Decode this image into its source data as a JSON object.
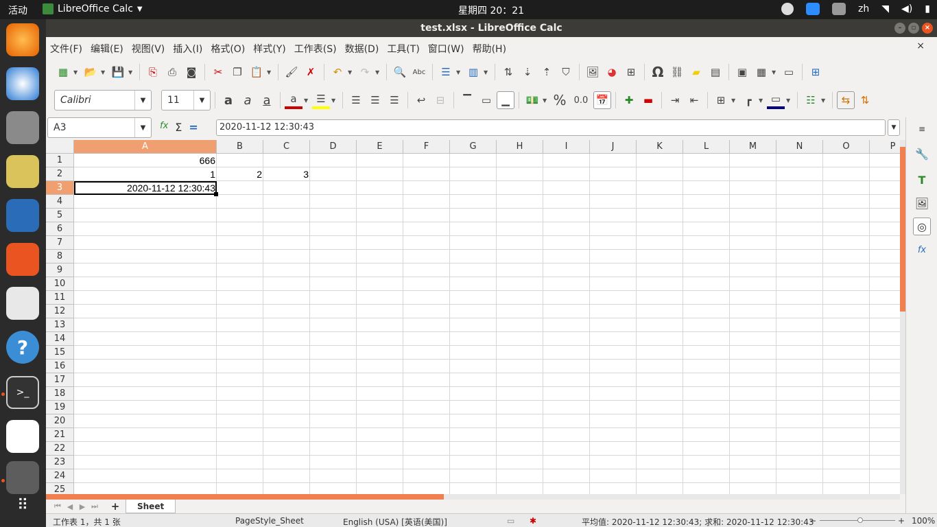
{
  "topbar": {
    "activities": "活动",
    "app_name": "LibreOffice Calc",
    "clock": "星期四 20：21",
    "lang": "zh"
  },
  "window": {
    "title": "test.xlsx - LibreOffice Calc"
  },
  "menu": [
    "文件(F)",
    "编辑(E)",
    "视图(V)",
    "插入(I)",
    "格式(O)",
    "样式(Y)",
    "工作表(S)",
    "数据(D)",
    "工具(T)",
    "窗口(W)",
    "帮助(H)"
  ],
  "formatting": {
    "font_name": "Calibri",
    "font_size": "11",
    "percent_label": "%",
    "number_label": "0.0"
  },
  "formula_bar": {
    "name_box": "A3",
    "content": "2020-11-12 12:30:43"
  },
  "columns": [
    "A",
    "B",
    "C",
    "D",
    "E",
    "F",
    "G",
    "H",
    "I",
    "J",
    "K",
    "L",
    "M",
    "N",
    "O",
    "P"
  ],
  "selected_column": "A",
  "rows": [
    "1",
    "2",
    "3",
    "4",
    "5",
    "6",
    "7",
    "8",
    "9",
    "10",
    "11",
    "12",
    "13",
    "14",
    "15",
    "16",
    "17",
    "18",
    "19",
    "20",
    "21",
    "22",
    "23",
    "24",
    "25"
  ],
  "selected_row": "3",
  "cells": {
    "A1": "666",
    "A2": "1",
    "B2": "2",
    "C2": "3",
    "A3": "2020-11-12 12:30:43"
  },
  "sheet_tab": "Sheet",
  "status": {
    "sheet_count": "工作表 1，共 1 张",
    "page_style": "PageStyle_Sheet",
    "language": "English (USA) [英语(美国)]",
    "summary": "平均值: 2020-11-12 12:30:43; 求和: 2020-11-12 12:30:43",
    "zoom": "100%"
  },
  "colors": {
    "accent": "#e95420",
    "selection_header": "#f0a070",
    "dock_bg": "#2b2b2b",
    "titlebar_bg": "#3c3b37"
  }
}
